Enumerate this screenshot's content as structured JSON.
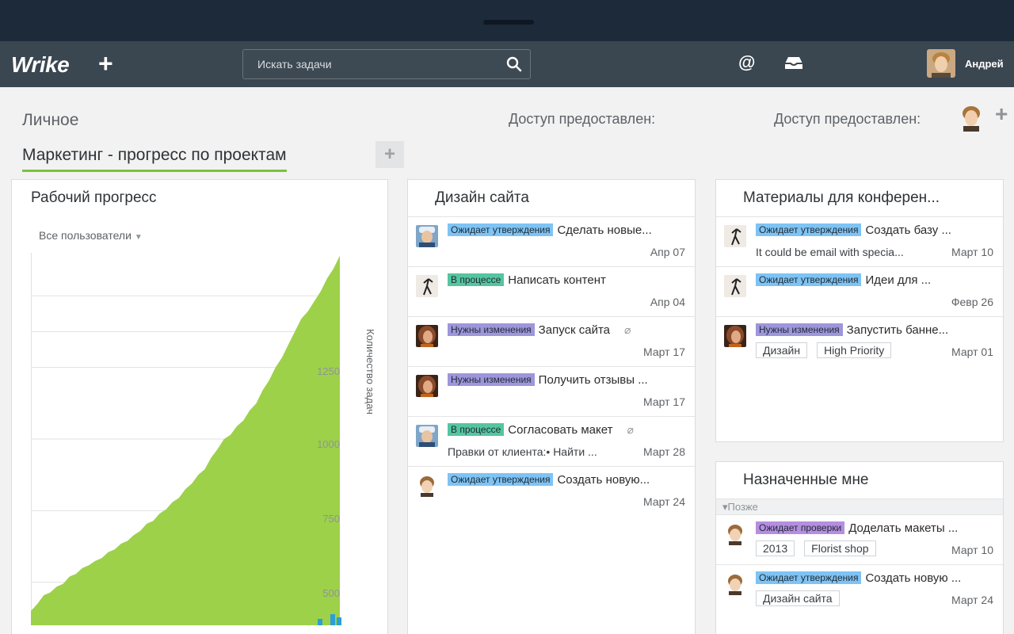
{
  "header": {
    "logo": "Wrike",
    "search_placeholder": "Искать задачи",
    "user_name": "Андрей"
  },
  "page": {
    "personal_label": "Личное",
    "shared_label_1": "Доступ предоставлен:",
    "shared_label_2": "Доступ предоставлен:",
    "active_tab": "Маркетинг - прогресс по проектам",
    "add_tab": "+"
  },
  "progress_widget": {
    "title": "Рабочий прогресс",
    "filter": "Все пользователи",
    "y_ticks": [
      "500",
      "750",
      "1000",
      "1250"
    ],
    "y_axis_title": "Количество задач"
  },
  "chart_data": {
    "type": "area",
    "title": "Рабочий прогресс",
    "ylabel": "Количество задач",
    "ylim": [
      350,
      1650
    ],
    "y_ticks": [
      500,
      750,
      1000,
      1250
    ],
    "series": [
      {
        "values": [
          400,
          430,
          455,
          470,
          485,
          500,
          520,
          535,
          550,
          565,
          575,
          590,
          605,
          620,
          635,
          650,
          665,
          685,
          705,
          720,
          740,
          760,
          780,
          800,
          825,
          850,
          875,
          900,
          935,
          970,
          1000,
          1020,
          1045,
          1070,
          1100,
          1130,
          1170,
          1210,
          1250,
          1290,
          1330,
          1380,
          1420,
          1450,
          1480,
          1520,
          1560,
          1600,
          1640
        ]
      }
    ],
    "colors": {
      "area": "#9dd14a",
      "accent": "#2a9fd8"
    }
  },
  "design_widget": {
    "title": "Дизайн сайта",
    "tasks": [
      {
        "status": "Ожидает утверждения",
        "status_type": "wait",
        "title": "Сделать новые...",
        "note": "",
        "date": "Апр 07",
        "clip": false,
        "avatar": "man-cap"
      },
      {
        "status": "В процессе",
        "status_type": "prog",
        "title": "Написать контент",
        "note": "",
        "date": "Апр 04",
        "clip": false,
        "avatar": "figure"
      },
      {
        "status": "Нужны изменения",
        "status_type": "need",
        "title": "Запуск сайта",
        "note": "",
        "date": "Март 17",
        "clip": true,
        "avatar": "woman"
      },
      {
        "status": "Нужны изменения",
        "status_type": "need",
        "title": "Получить отзывы ...",
        "note": "",
        "date": "Март 17",
        "clip": false,
        "avatar": "woman"
      },
      {
        "status": "В процессе",
        "status_type": "prog",
        "title": "Согласовать макет",
        "note": "Правки от клиента:• Найти ...",
        "date": "Март 28",
        "clip": true,
        "avatar": "man-cap"
      },
      {
        "status": "Ожидает утверждения",
        "status_type": "wait",
        "title": "Создать новую...",
        "note": "",
        "date": "Март 24",
        "clip": false,
        "avatar": "man-curly"
      }
    ]
  },
  "conf_widget": {
    "title": "Материалы для конферен...",
    "tasks": [
      {
        "status": "Ожидает утверждения",
        "status_type": "wait",
        "title": "Создать базу ...",
        "note": "It could be email with specia...",
        "date": "Март 10",
        "tags": [],
        "avatar": "figure"
      },
      {
        "status": "Ожидает утверждения",
        "status_type": "wait",
        "title": "Идеи для ...",
        "note": "",
        "date": "Февр 26",
        "tags": [],
        "avatar": "figure"
      },
      {
        "status": "Нужны изменения",
        "status_type": "need",
        "title": "Запустить банне...",
        "note": "",
        "date": "Март 01",
        "tags": [
          "Дизайн",
          "High Priority"
        ],
        "avatar": "woman"
      }
    ]
  },
  "assigned_widget": {
    "title": "Назначенные мне",
    "group_label": "▾Позже",
    "tasks": [
      {
        "status": "Ожидает проверки",
        "status_type": "rev",
        "title": "Доделать макеты ...",
        "date": "Март 10",
        "tags": [
          "2013",
          "Florist shop"
        ],
        "avatar": "man-curly"
      },
      {
        "status": "Ожидает утверждения",
        "status_type": "wait",
        "title": "Создать новую ...",
        "date": "Март 24",
        "tags": [
          "Дизайн сайта"
        ],
        "avatar": "man-curly"
      }
    ]
  }
}
